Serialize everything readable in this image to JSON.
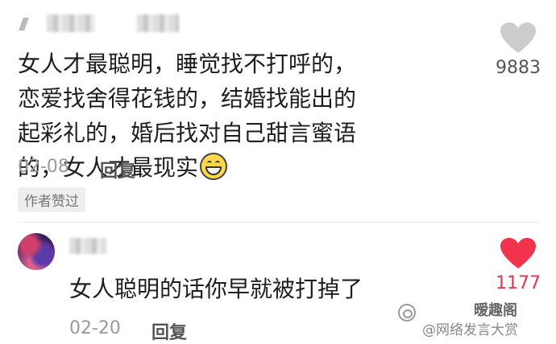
{
  "comments": [
    {
      "text": "女人才最聪明，睡觉找不打呼的，恋爱找舍得花钱的，结婚找能出的起彩礼的，婚后找对自己甜言蜜语的，女人才最现实",
      "date": "02-08",
      "reply_label": "回复",
      "like_count": "9883",
      "like_color": "#cccccc",
      "author_badge": "作者赞过",
      "emoji": "grinning-face-icon"
    },
    {
      "text": "女人聪明的话你早就被打掉了",
      "date": "02-20",
      "reply_label": "回复",
      "like_count": "1177",
      "like_color": "#f2334d"
    }
  ],
  "watermark": {
    "account": "暧趣阁",
    "source": "@网络发言大赏"
  }
}
